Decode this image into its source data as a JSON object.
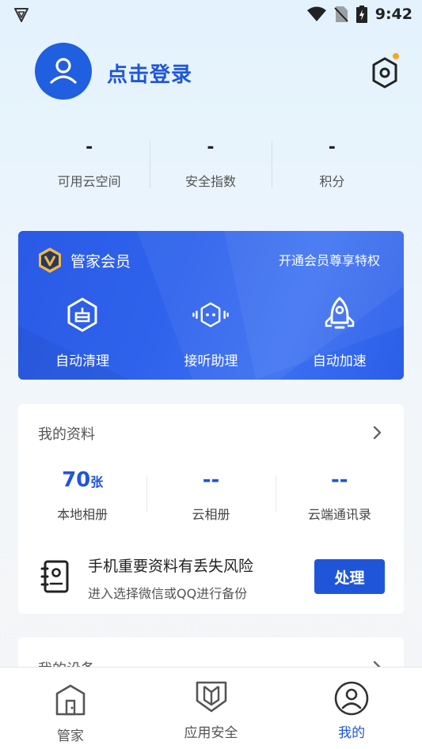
{
  "status_bar": {
    "time": "9:42"
  },
  "header": {
    "login_label": "点击登录"
  },
  "stats": [
    {
      "value": "-",
      "label": "可用云空间"
    },
    {
      "value": "-",
      "label": "安全指数"
    },
    {
      "value": "-",
      "label": "积分"
    }
  ],
  "vip": {
    "title": "管家会员",
    "link": "开通会员尊享特权",
    "features": [
      {
        "icon": "auto-clean-icon",
        "label": "自动清理"
      },
      {
        "icon": "call-assistant-icon",
        "label": "接听助理"
      },
      {
        "icon": "rocket-icon",
        "label": "自动加速"
      }
    ]
  },
  "my_data": {
    "title": "我的资料",
    "stats": [
      {
        "value": "70",
        "unit": "张",
        "label": "本地相册"
      },
      {
        "value": "--",
        "unit": "",
        "label": "云相册"
      },
      {
        "value": "--",
        "unit": "",
        "label": "云端通讯录"
      }
    ],
    "risk_title": "手机重要资料有丢失风险",
    "risk_sub": "进入选择微信或QQ进行备份",
    "risk_button": "处理"
  },
  "my_devices": {
    "title": "我的设备"
  },
  "bottom_nav": [
    {
      "icon": "home-icon",
      "label": "管家",
      "active": false
    },
    {
      "icon": "app-security-icon",
      "label": "应用安全",
      "active": false
    },
    {
      "icon": "profile-icon",
      "label": "我的",
      "active": true
    }
  ],
  "colors": {
    "accent": "#1f56d9",
    "vip_bg": "#2f63ec",
    "notification_dot": "#f6a623"
  }
}
